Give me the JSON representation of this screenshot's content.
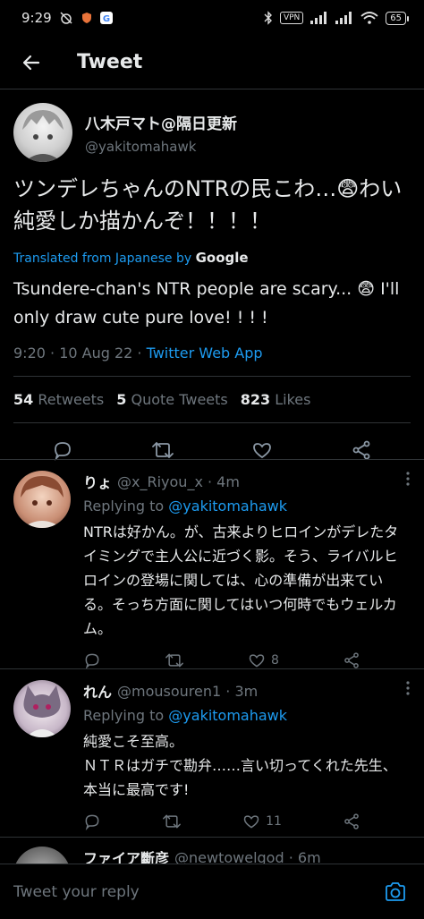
{
  "status_bar": {
    "time": "9:29",
    "vpn": "VPN",
    "battery": "65"
  },
  "header": {
    "title": "Tweet"
  },
  "main_tweet": {
    "author_name": "八木戸マト@隔日更新",
    "author_handle": "@yakitomahawk",
    "text": "ツンデレちゃんのNTRの民こわ…😨わい純愛しか描かんぞ！！！！",
    "translated_label": "Translated from Japanese by",
    "translator": "Google",
    "translation": "Tsundere-chan's NTR people are scary... 😨 I'll only draw cute pure love! ! ! !",
    "time": "9:20 · 10 Aug 22",
    "source": "Twitter Web App",
    "retweets_count": "54",
    "retweets_label": "Retweets",
    "quotes_count": "5",
    "quotes_label": "Quote Tweets",
    "likes_count": "823",
    "likes_label": "Likes"
  },
  "replies": [
    {
      "name": "りょ",
      "handle": "@x_Riyou_x · 4m",
      "replying_label": "Replying to",
      "replying_to": "@yakitomahawk",
      "text": "NTRは好かん。が、古来よりヒロインがデレたタイミングで主人公に近づく影。そう、ライバルヒロインの登場に関しては、心の準備が出来ている。そっち方面に関してはいつ何時でもウェルカム。",
      "likes": "8"
    },
    {
      "name": "れん",
      "handle": "@mousouren1 · 3m",
      "replying_label": "Replying to",
      "replying_to": "@yakitomahawk",
      "text": "純愛こそ至高。\nＮＴＲはガチで勘弁……言い切ってくれた先生、本当に最高です!",
      "likes": "11"
    },
    {
      "name": "ファイア斷彦",
      "handle": "@newtowelgod · 6m"
    }
  ],
  "compose": {
    "placeholder": "Tweet your reply"
  },
  "colors": {
    "accent": "#1d9bf0",
    "background": "#000000",
    "divider": "#2f3336",
    "muted": "#6e767d"
  }
}
